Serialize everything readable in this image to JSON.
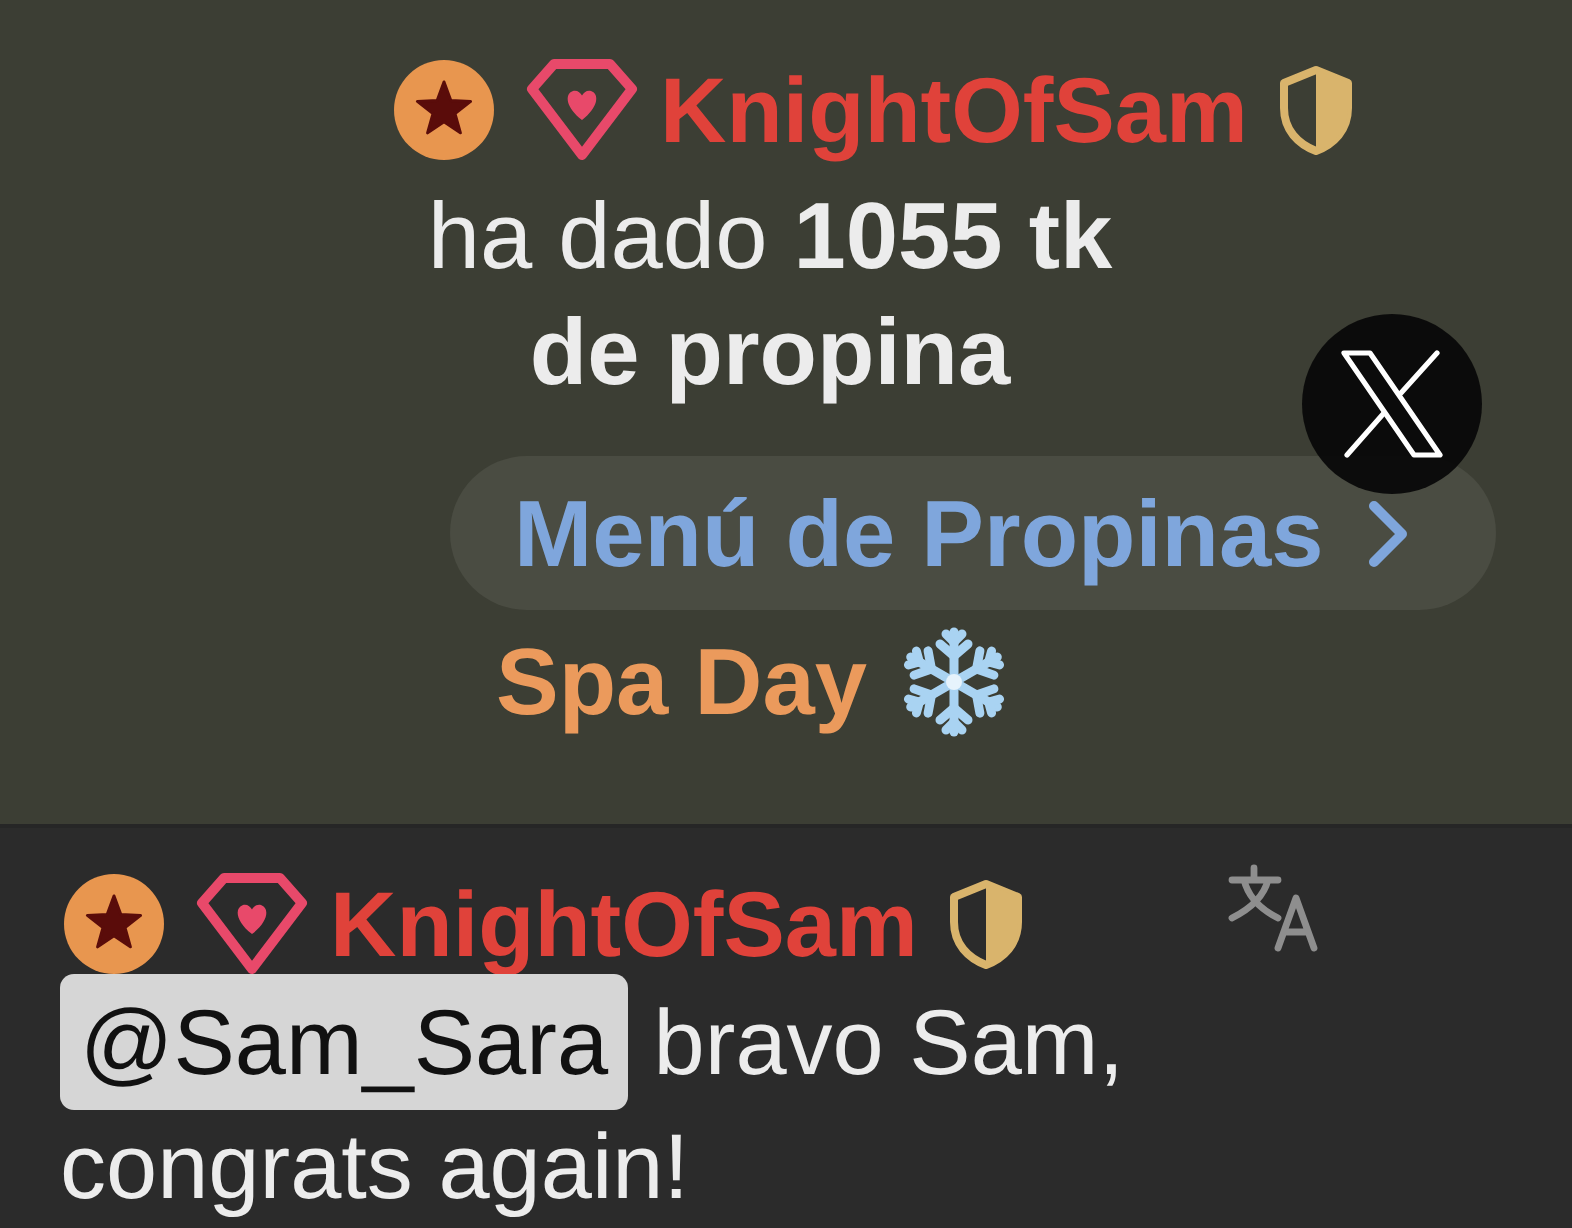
{
  "tip_notice": {
    "user": {
      "name": "KnightOfSam"
    },
    "message": "ha dado **1055 tk de propina**",
    "tip_menu_button": {
      "label": "Menú de Propinas"
    },
    "tip_item": {
      "label": "Spa Day"
    }
  },
  "chat_messages": [
    {
      "user": {
        "name": "KnightOfSam"
      },
      "mention": "@Sam_Sara",
      "text": " bravo Sam, congrats again!"
    }
  ]
}
